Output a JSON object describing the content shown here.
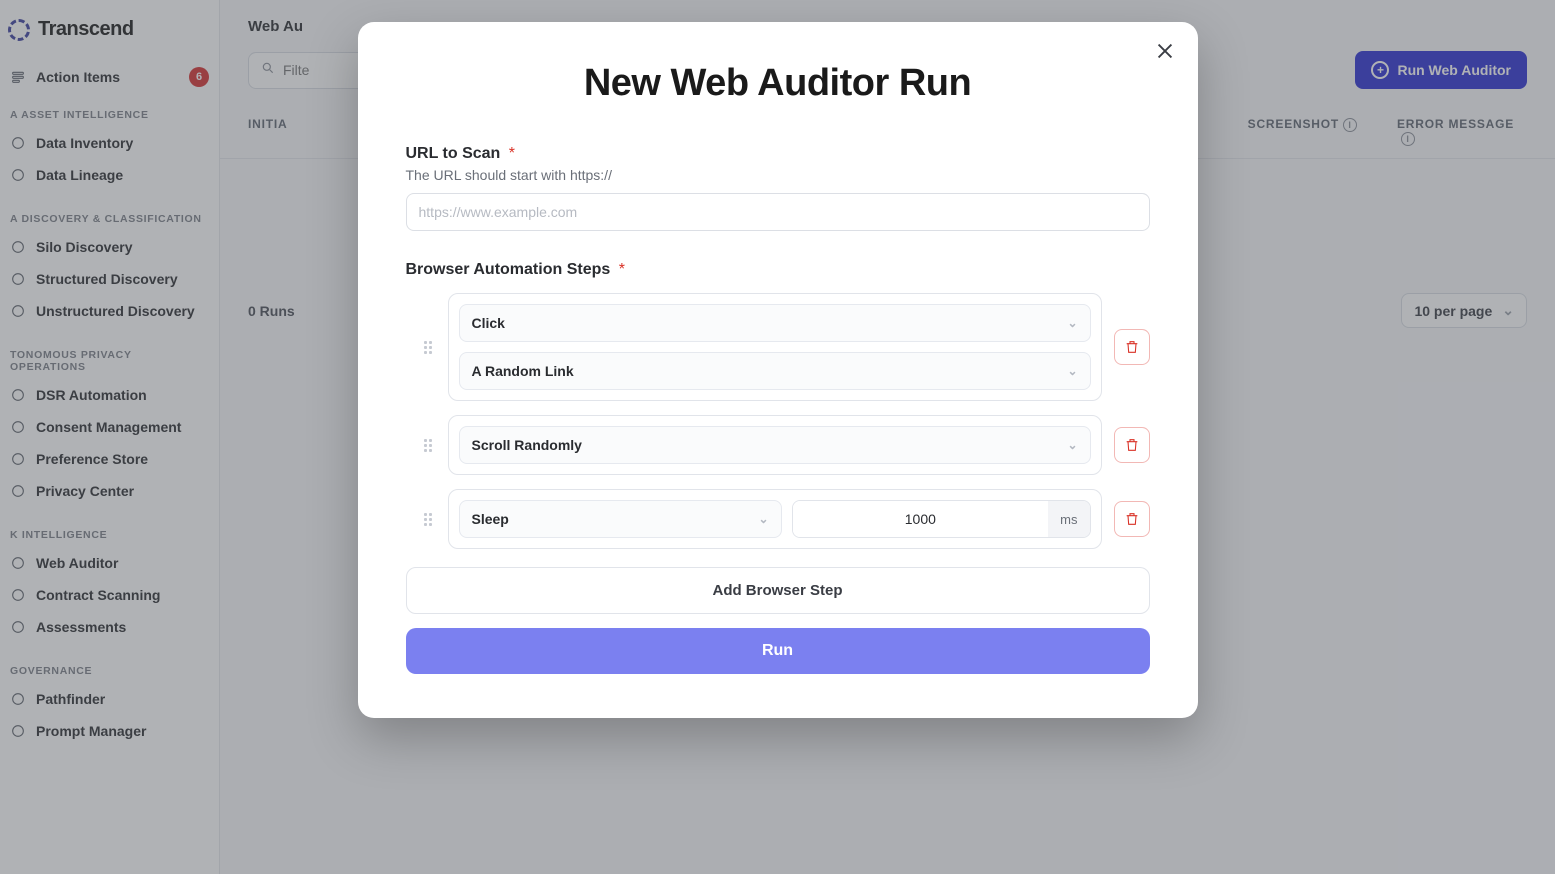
{
  "brand": {
    "name": "Transcend"
  },
  "sidebar": {
    "action_items": {
      "label": "Action Items",
      "badge": "6"
    },
    "groups": [
      {
        "title": "A ASSET INTELLIGENCE",
        "items": [
          {
            "label": "Data Inventory"
          },
          {
            "label": "Data Lineage"
          }
        ]
      },
      {
        "title": "A DISCOVERY & CLASSIFICATION",
        "items": [
          {
            "label": "Silo Discovery"
          },
          {
            "label": "Structured Discovery"
          },
          {
            "label": "Unstructured Discovery"
          }
        ]
      },
      {
        "title": "TONOMOUS PRIVACY OPERATIONS",
        "items": [
          {
            "label": "DSR Automation"
          },
          {
            "label": "Consent Management"
          },
          {
            "label": "Preference Store"
          },
          {
            "label": "Privacy Center"
          }
        ]
      },
      {
        "title": "K INTELLIGENCE",
        "items": [
          {
            "label": "Web Auditor"
          },
          {
            "label": "Contract Scanning"
          },
          {
            "label": "Assessments"
          }
        ]
      },
      {
        "title": "GOVERNANCE",
        "items": [
          {
            "label": "Pathfinder"
          },
          {
            "label": "Prompt Manager"
          }
        ]
      }
    ]
  },
  "page": {
    "breadcrumb": "Web Au",
    "search_placeholder": "Filte",
    "run_button": "Run Web Auditor",
    "columns": {
      "initiated": "INITIA",
      "screenshot": "SCREENSHOT",
      "error": "ERROR MESSAGE"
    },
    "runs_count": "0 Runs",
    "page_size": "10 per page"
  },
  "modal": {
    "title": "New Web Auditor Run",
    "url_label": "URL to Scan",
    "url_help": "The URL should start with https://",
    "url_placeholder": "https://www.example.com",
    "steps_label": "Browser Automation Steps",
    "steps": [
      {
        "type": "click",
        "action": "Click",
        "target": "A Random Link"
      },
      {
        "type": "scroll",
        "action": "Scroll Randomly"
      },
      {
        "type": "sleep",
        "action": "Sleep",
        "value": "1000",
        "unit": "ms"
      }
    ],
    "add_step": "Add Browser Step",
    "submit": "Run"
  }
}
